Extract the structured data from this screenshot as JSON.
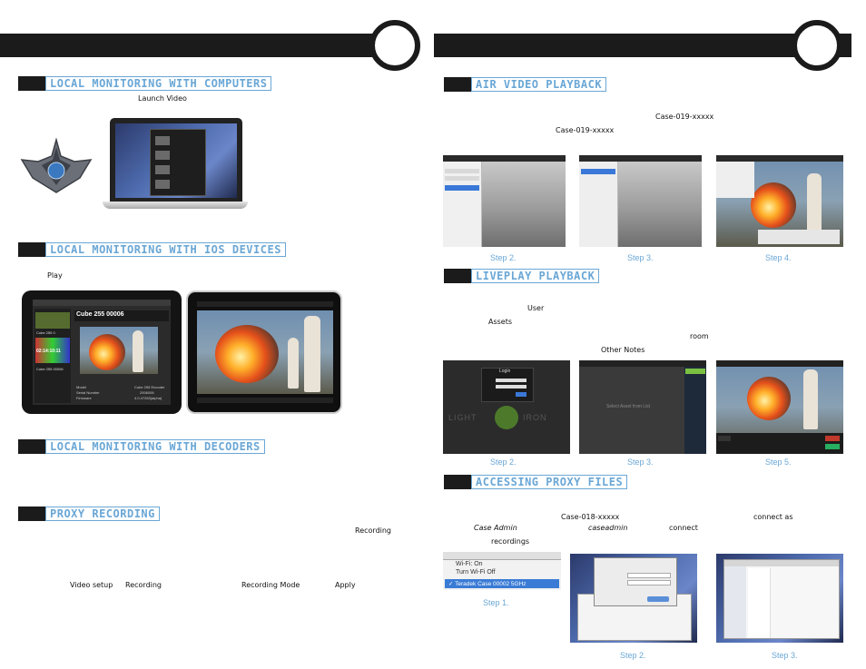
{
  "left": {
    "sections": [
      {
        "title": "LOCAL MONITORING WITH COMPUTERS"
      },
      {
        "title": "LOCAL MONITORING WITH IOS DEVICES"
      },
      {
        "title": "LOCAL MONITORING WITH DECODERS"
      },
      {
        "title": "PROXY RECORDING"
      }
    ],
    "keywords": {
      "launch_video": "Launch Video",
      "play": "Play",
      "recording": "Recording",
      "video_setup": "Video setup",
      "recording2": "Recording",
      "recording_mode": "Recording Mode",
      "apply": "Apply"
    },
    "ipad": {
      "clip_title": "Cube 255 00006",
      "list_item_1": "Cube 255 0",
      "list_item_2": "Cube 255 00006",
      "timecode": "02:14:10:11",
      "model_label": "Model",
      "model_value": "Cube 255 Encoder",
      "serial_label": "Serial Number",
      "serial_value": "2006006",
      "firmware_label": "Firmware",
      "firmware_value": "4.0.47283(alpha)"
    }
  },
  "right": {
    "sections": [
      {
        "title": "AIR VIDEO PLAYBACK"
      },
      {
        "title": "LIVEPLAY PLAYBACK"
      },
      {
        "title": "ACCESSING PROXY FILES"
      }
    ],
    "keywords": {
      "case_1": "Case-019-xxxxx",
      "case_2": "Case-019-xxxxx",
      "user": "User",
      "assets": "Assets",
      "room": "room",
      "other_notes": "Other Notes",
      "case_3": "Case-018-xxxxx",
      "connect_as": "connect as",
      "case_admin": "Case Admin",
      "caseadmin": "caseadmin",
      "connect": "connect",
      "recordings": "recordings"
    },
    "air_captions": [
      "Step 2.",
      "Step 3.",
      "Step 4."
    ],
    "live_captions": [
      "Step 2.",
      "Step 3.",
      "Step 5."
    ],
    "proxy_captions": [
      "Step 1.",
      "Step 2.",
      "Step 3."
    ],
    "liveplay": {
      "login": "Login",
      "brand_left": "LIGHT",
      "brand_right": "IRON",
      "select_asset": "Select Asset from List"
    },
    "wifi": {
      "on": "Wi-Fi: On",
      "off": "Turn Wi-Fi Off",
      "network": "✓ Teradek Case 00002 5GHz"
    }
  }
}
